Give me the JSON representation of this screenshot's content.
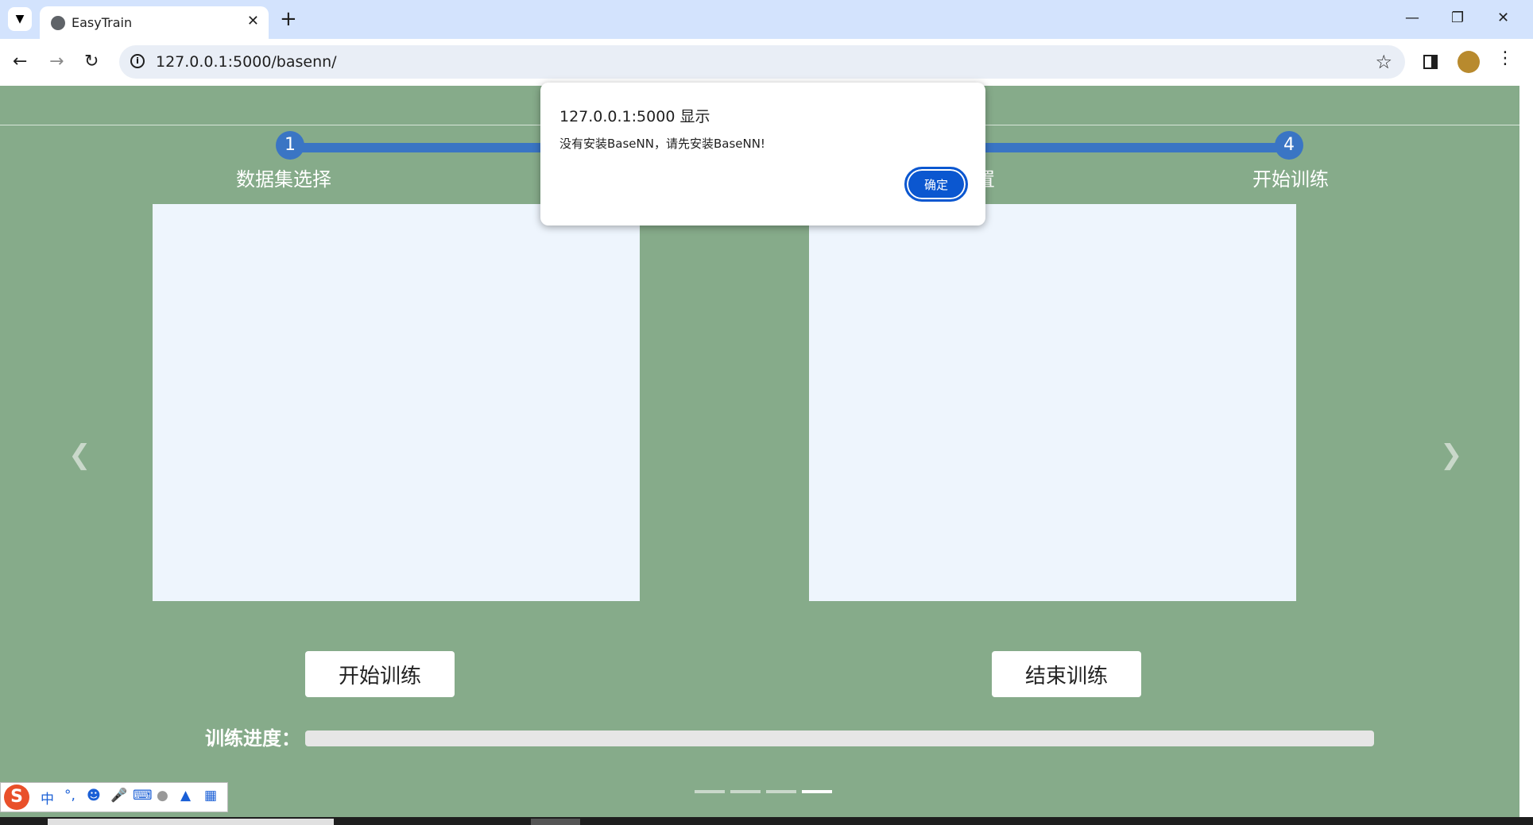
{
  "browser": {
    "tab_title": "EasyTrain",
    "url": "127.0.0.1:5000/basenn/"
  },
  "steps": [
    {
      "number": "1",
      "label": "数据集选择"
    },
    {
      "number": "",
      "label": ""
    },
    {
      "number": "",
      "label": "置"
    },
    {
      "number": "4",
      "label": "开始训练"
    }
  ],
  "buttons": {
    "start": "开始训练",
    "stop": "结束训练"
  },
  "progress": {
    "label": "训练进度：",
    "value": 0
  },
  "carousel": {
    "active_index": 3,
    "count": 4
  },
  "dialog": {
    "title": "127.0.0.1:5000 显示",
    "message": "没有安装BaseNN，请先安装BaseNN!",
    "ok_label": "确定"
  },
  "ime": {
    "logo": "S",
    "mode": "中",
    "punct": "°,"
  },
  "colors": {
    "page_bg": "#86ab8a",
    "accent": "#3a75c4",
    "panel": "#eef5fd",
    "dialog_button": "#0b57d0"
  }
}
